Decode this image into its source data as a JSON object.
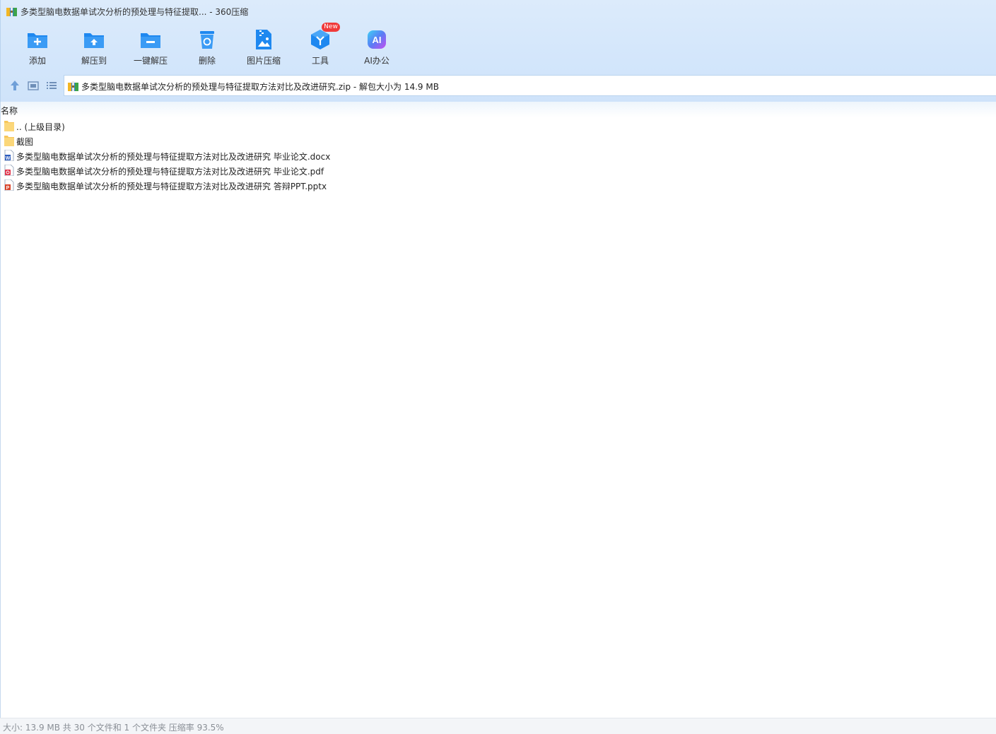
{
  "window": {
    "title": "多类型脑电数据单试次分析的预处理与特征提取... - 360压缩"
  },
  "toolbar": {
    "items": [
      {
        "label": "添加",
        "icon": "add-folder-icon"
      },
      {
        "label": "解压到",
        "icon": "extract-to-icon"
      },
      {
        "label": "一键解压",
        "icon": "one-click-extract-icon"
      },
      {
        "label": "删除",
        "icon": "trash-icon"
      },
      {
        "label": "图片压缩",
        "icon": "image-compress-icon"
      },
      {
        "label": "工具",
        "icon": "tools-icon"
      },
      {
        "label": "AI办公",
        "icon": "ai-office-icon"
      }
    ],
    "new_badge": "New",
    "accent": "#1e88f0"
  },
  "address": {
    "text": "多类型脑电数据单试次分析的预处理与特征提取方法对比及改进研究.zip - 解包大小为 14.9 MB"
  },
  "list": {
    "header_name": "名称",
    "rows": [
      {
        "name": ".. (上级目录)",
        "icon": "folder-icon"
      },
      {
        "name": "截图",
        "icon": "folder-icon"
      },
      {
        "name": "多类型脑电数据单试次分析的预处理与特征提取方法对比及改进研究 毕业论文.docx",
        "icon": "word-file-icon"
      },
      {
        "name": "多类型脑电数据单试次分析的预处理与特征提取方法对比及改进研究 毕业论文.pdf",
        "icon": "pdf-file-icon"
      },
      {
        "name": "多类型脑电数据单试次分析的预处理与特征提取方法对比及改进研究 答辩PPT.pptx",
        "icon": "ppt-file-icon"
      }
    ]
  },
  "status": {
    "text": "大小: 13.9 MB 共 30 个文件和 1 个文件夹 压缩率 93.5%"
  }
}
